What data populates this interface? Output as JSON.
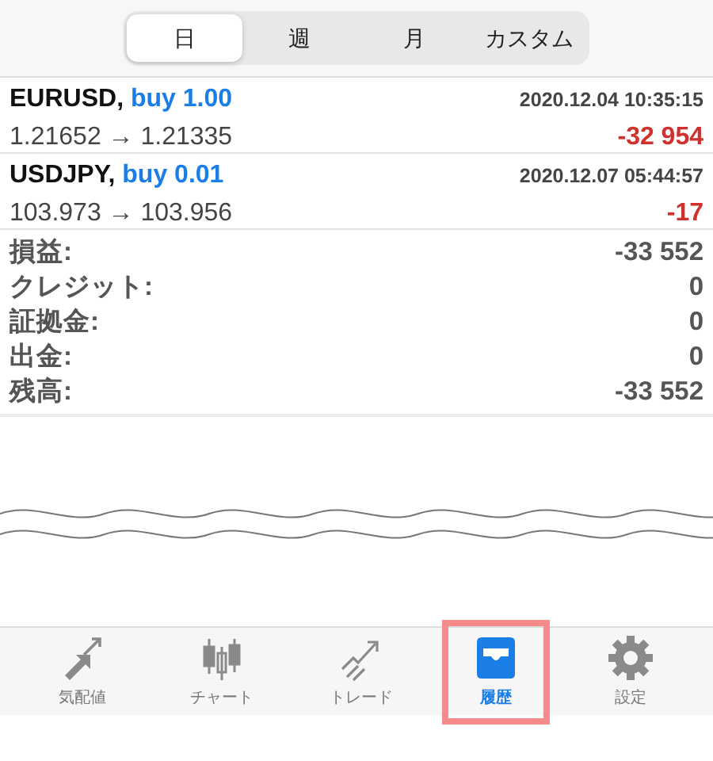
{
  "period_tabs": [
    {
      "label": "日",
      "selected": true
    },
    {
      "label": "週",
      "selected": false
    },
    {
      "label": "月",
      "selected": false
    },
    {
      "label": "カスタム",
      "selected": false
    }
  ],
  "deals": [
    {
      "symbol": "EURUSD,",
      "action": "buy 1.00",
      "time": "2020.12.04 10:35:15",
      "prices": "1.21652 → 1.21335",
      "profit": "-32 954"
    },
    {
      "symbol": "USDJPY,",
      "action": "buy 0.01",
      "time": "2020.12.07 05:44:57",
      "prices": "103.973 → 103.956",
      "profit": "-17"
    }
  ],
  "summary": [
    {
      "label": "損益:",
      "value": "-33 552"
    },
    {
      "label": "クレジット:",
      "value": "0"
    },
    {
      "label": "証拠金:",
      "value": "0"
    },
    {
      "label": "出金:",
      "value": "0"
    },
    {
      "label": "残高:",
      "value": "-33 552"
    }
  ],
  "bottom_tabs": [
    {
      "kind": "quotes",
      "label": "気配値",
      "selected": false,
      "highlighted": false
    },
    {
      "kind": "chart",
      "label": "チャート",
      "selected": false,
      "highlighted": false
    },
    {
      "kind": "trade",
      "label": "トレード",
      "selected": false,
      "highlighted": false
    },
    {
      "kind": "history",
      "label": "履歴",
      "selected": true,
      "highlighted": true
    },
    {
      "kind": "settings",
      "label": "設定",
      "selected": false,
      "highlighted": false
    }
  ]
}
